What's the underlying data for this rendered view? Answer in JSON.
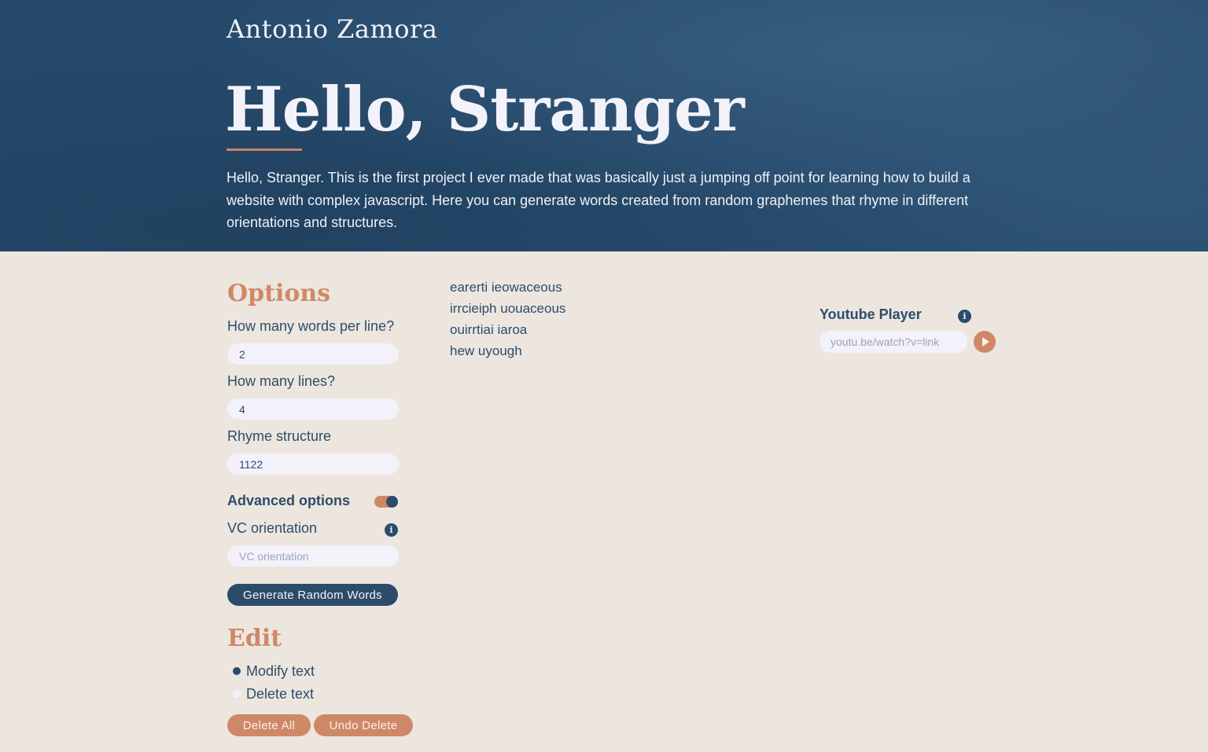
{
  "header": {
    "brand": "Antonio Zamora",
    "title": "Hello, Stranger",
    "description": "Hello, Stranger. This is the first project I ever made that was basically just a jumping off point for learning how to build a website with complex javascript. Here you can generate words created from random graphemes that rhyme in different orientations and structures."
  },
  "options": {
    "title": "Options",
    "words_per_line_label": "How many words per line?",
    "words_per_line_value": "2",
    "lines_label": "How many lines?",
    "lines_value": "4",
    "rhyme_label": "Rhyme structure",
    "rhyme_value": "1122",
    "advanced_label": "Advanced options",
    "advanced_enabled": true,
    "vc_label": "VC orientation",
    "vc_placeholder": "VC orientation",
    "generate_label": "Generate Random Words"
  },
  "edit": {
    "title": "Edit",
    "modify_label": "Modify text",
    "delete_label": "Delete text",
    "selected": "Modify text",
    "delete_all_label": "Delete All",
    "undo_delete_label": "Undo Delete"
  },
  "output": {
    "lines": [
      "earerti ieowaceous",
      "irrcieiph uouaceous",
      "ouirrtiai iaroa",
      "hew uyough"
    ]
  },
  "youtube": {
    "title": "Youtube Player",
    "placeholder": "youtu.be/watch?v=link"
  },
  "icons": {
    "info": "info-icon",
    "play": "play-icon"
  },
  "colors": {
    "primary": "#2c4b6a",
    "accent": "#cf8867",
    "background": "#ece6de",
    "hero": "#264a6b"
  }
}
